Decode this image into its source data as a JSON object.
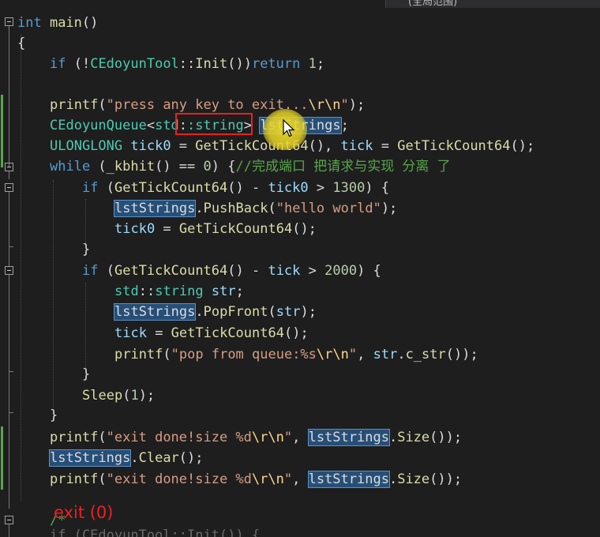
{
  "editor": {
    "top_tab": "(全局范围)",
    "lines": {
      "l01": {
        "a": "int",
        "b": " main",
        "c": "()"
      },
      "l02": {
        "a": "{"
      },
      "l03": {
        "a": "if",
        "b": " (!",
        "c": "CEdoyunTool",
        "d": "::",
        "e": "Init",
        "f": "())",
        "g": "return",
        "h": " ",
        "i": "1",
        "j": ";"
      },
      "l05": {
        "a": "printf",
        "b": "(",
        "c": "\"press any key to exit...",
        "d": "\\r\\n",
        "e": "\"",
        "f": ");"
      },
      "l06": {
        "a": "CEdoyunQueue",
        "b": "<",
        "c": "std",
        "d": ":",
        "e": ":string",
        "f": ">",
        "g": " ",
        "h": "lstStrings",
        "i": ";"
      },
      "l07": {
        "a": "ULONGLONG",
        "b": " ",
        "c": "tick0",
        "d": " = ",
        "e": "GetTickCount64",
        "f": "(), ",
        "g": "tick",
        "h": " = ",
        "i": "GetTickCount64",
        "j": "();"
      },
      "l08": {
        "a": "while",
        "b": " (",
        "c": "_kbhit",
        "d": "() == ",
        "e": "0",
        "f": ") {",
        "g": "//完成端口 把请求与实现 分离 了"
      },
      "l09": {
        "a": "if",
        "b": " (",
        "c": "GetTickCount64",
        "d": "() - ",
        "e": "tick0",
        "f": " > ",
        "g": "1300",
        "h": ") {"
      },
      "l10": {
        "a": "lstStrings",
        "b": ".",
        "c": "PushBack",
        "d": "(",
        "e": "\"hello world\"",
        "f": ");"
      },
      "l11": {
        "a": "tick0",
        "b": " = ",
        "c": "GetTickCount64",
        "d": "();"
      },
      "l12": {
        "a": "}"
      },
      "l13": {
        "a": "if",
        "b": " (",
        "c": "GetTickCount64",
        "d": "() - ",
        "e": "tick",
        "f": " > ",
        "g": "2000",
        "h": ") {"
      },
      "l14": {
        "a": "std",
        "b": "::",
        "c": "string",
        "d": " ",
        "e": "str",
        "f": ";"
      },
      "l15": {
        "a": "lstStrings",
        "b": ".",
        "c": "PopFront",
        "d": "(",
        "e": "str",
        "f": ");"
      },
      "l16": {
        "a": "tick",
        "b": " = ",
        "c": "GetTickCount64",
        "d": "();"
      },
      "l17": {
        "a": "printf",
        "b": "(",
        "c": "\"pop from queue:%s",
        "d": "\\r\\n",
        "e": "\"",
        "f": ", ",
        "g": "str",
        "h": ".",
        "i": "c_str",
        "j": "());"
      },
      "l18": {
        "a": "}"
      },
      "l19": {
        "a": "Sleep",
        "b": "(",
        "c": "1",
        "d": ");"
      },
      "l20": {
        "a": "}"
      },
      "l21": {
        "a": "printf",
        "b": "(",
        "c": "\"exit done!size %d",
        "d": "\\r\\n",
        "e": "\"",
        "f": ", ",
        "g": "lstStrings",
        "h": ".",
        "i": "Size",
        "j": "());"
      },
      "l22": {
        "a": "lstStrings",
        "b": ".",
        "c": "Clear",
        "d": "();"
      },
      "l23": {
        "a": "printf",
        "b": "(",
        "c": "\"exit done!size %d",
        "d": "\\r\\n",
        "e": "\"",
        "f": ", ",
        "g": "lstStrings",
        "h": ".",
        "i": "Size",
        "j": "());"
      },
      "l24": {
        "a": "/*"
      }
    },
    "partial_line": "if (CEdoyunTool::Init()) {",
    "annotation": "exit (0)"
  },
  "colors": {
    "background": "#1e1e1e",
    "keyword": "#569cd6",
    "type": "#4ec9b0",
    "function": "#dcdcaa",
    "string": "#d69d85",
    "number": "#b5cea8",
    "comment": "#57a64a",
    "highlight": "#264f78",
    "annotation_red": "#f01f1f"
  },
  "icons": [
    "fold-collapse-icon",
    "mouse-cursor-icon"
  ]
}
